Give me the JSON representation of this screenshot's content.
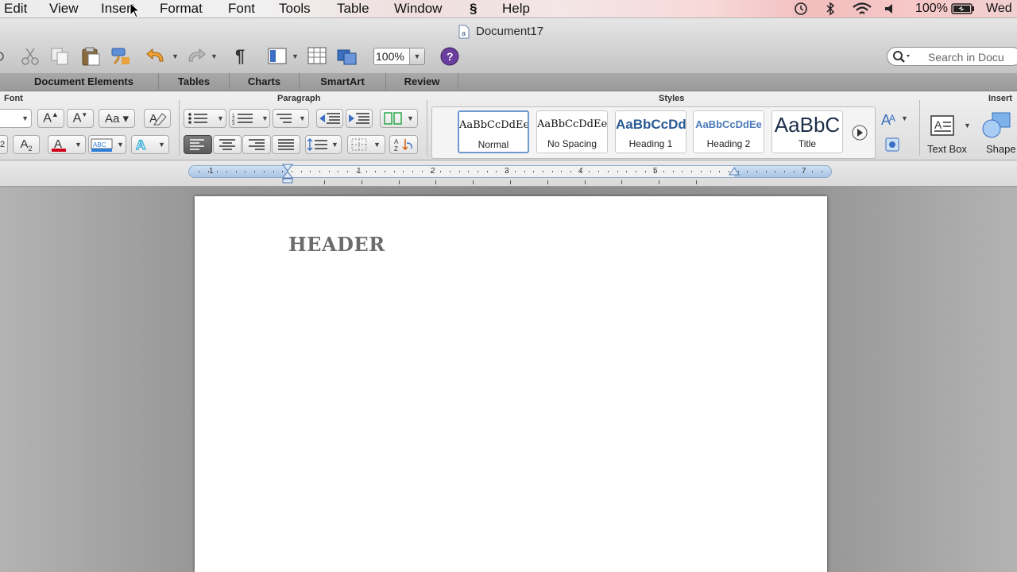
{
  "menubar": {
    "items": [
      "Edit",
      "View",
      "Insert",
      "Format",
      "Font",
      "Tools",
      "Table",
      "Window",
      "Help"
    ],
    "battery": "100%",
    "day": "Wed"
  },
  "window": {
    "title": "Document17"
  },
  "toolbar": {
    "zoom": "100%",
    "search_placeholder": "Search in Docu"
  },
  "ribbon_tabs": [
    "Document Elements",
    "Tables",
    "Charts",
    "SmartArt",
    "Review"
  ],
  "ribbon": {
    "groups": {
      "font": "Font",
      "paragraph": "Paragraph",
      "styles": "Styles",
      "insert": "Insert"
    },
    "styles": [
      {
        "sample": "AaBbCcDdEe",
        "name": "Normal"
      },
      {
        "sample": "AaBbCcDdEe",
        "name": "No Spacing"
      },
      {
        "sample": "AaBbCcDd",
        "name": "Heading 1"
      },
      {
        "sample": "AaBbCcDdEe",
        "name": "Heading 2"
      },
      {
        "sample": "AaBbC",
        "name": "Title"
      }
    ],
    "insert": {
      "text_box": "Text Box",
      "shape": "Shape"
    }
  },
  "ruler": {
    "numbers": [
      "1",
      "1",
      "2",
      "3",
      "4",
      "5",
      "7"
    ]
  },
  "document": {
    "header": "HEADER"
  },
  "colors": {
    "font_color_red": "#d0021b",
    "highlight_blue": "#2f7fd8",
    "help_purple": "#6b3fa0"
  }
}
